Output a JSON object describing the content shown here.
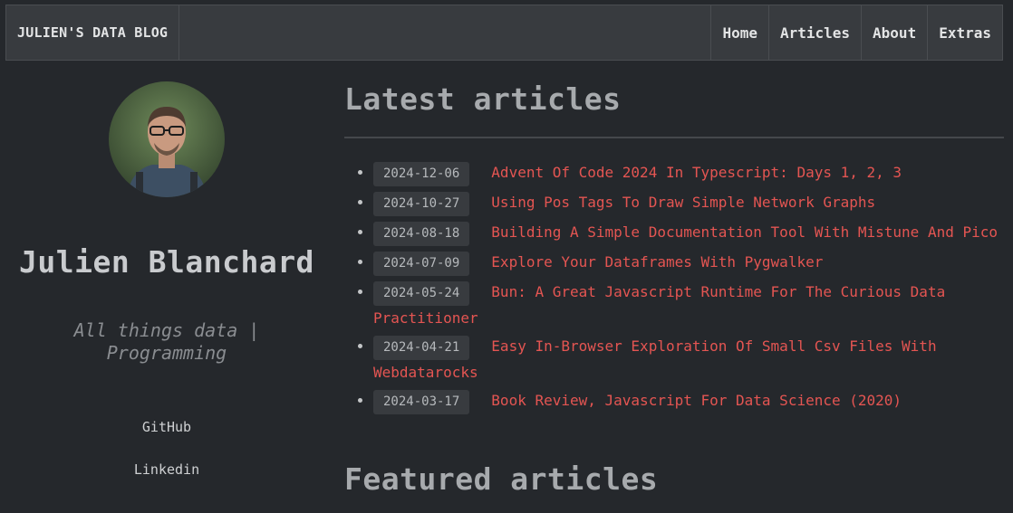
{
  "nav": {
    "brand": "JULIEN'S DATA BLOG",
    "items": [
      {
        "label": "Home"
      },
      {
        "label": "Articles"
      },
      {
        "label": "About"
      },
      {
        "label": "Extras"
      }
    ]
  },
  "sidebar": {
    "name": "Julien Blanchard",
    "tagline": "All things data | Programming",
    "links": {
      "github": "GitHub",
      "linkedin": "Linkedin"
    }
  },
  "main": {
    "latest_title": "Latest articles",
    "articles": [
      {
        "date": "2024-12-06",
        "title": "Advent Of Code 2024 In Typescript: Days 1, 2, 3"
      },
      {
        "date": "2024-10-27",
        "title": "Using Pos Tags To Draw Simple Network Graphs"
      },
      {
        "date": "2024-08-18",
        "title": "Building A Simple Documentation Tool With Mistune And Pico"
      },
      {
        "date": "2024-07-09",
        "title": "Explore Your Dataframes With Pygwalker"
      },
      {
        "date": "2024-05-24",
        "title": "Bun: A Great Javascript Runtime For The Curious Data Practitioner"
      },
      {
        "date": "2024-04-21",
        "title": "Easy In-Browser Exploration Of Small Csv Files With Webdatarocks"
      },
      {
        "date": "2024-03-17",
        "title": "Book Review, Javascript For Data Science (2020)"
      }
    ],
    "featured_title": "Featured articles"
  },
  "colors": {
    "background": "#25282c",
    "navbar": "#383b3f",
    "link": "#e45552"
  }
}
